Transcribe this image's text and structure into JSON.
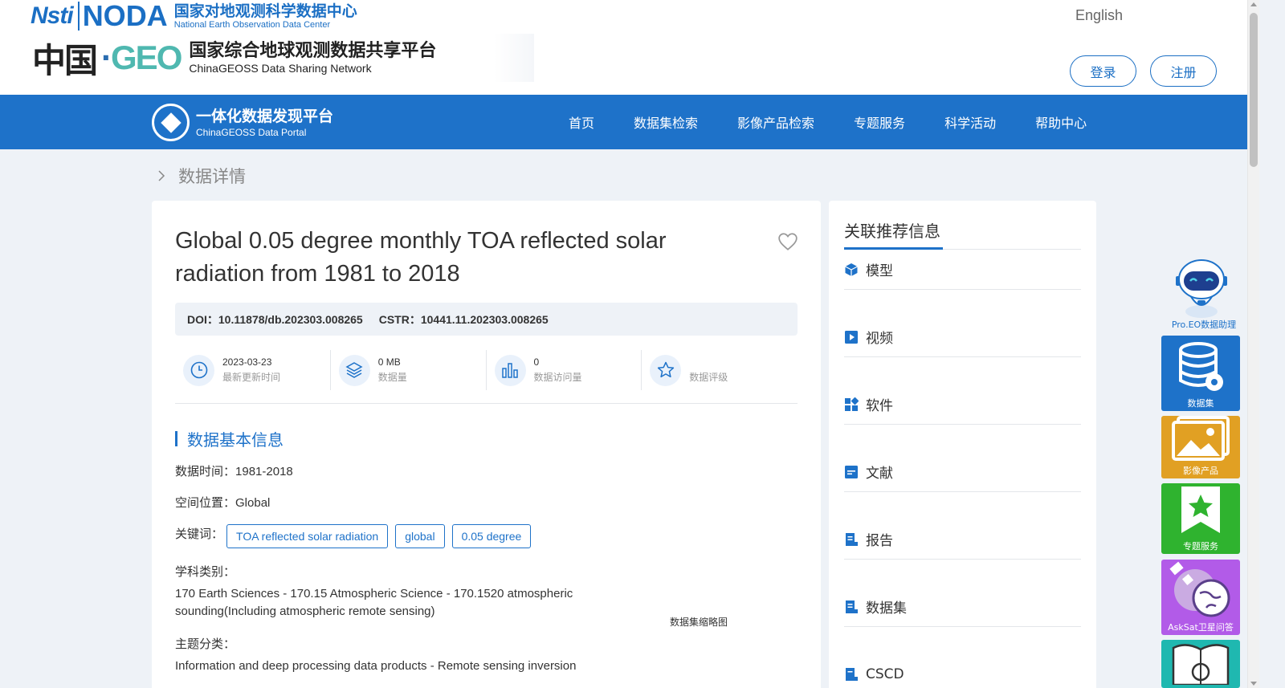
{
  "header": {
    "nsti_logo": "Nsti",
    "noda_logo": "NODA",
    "noda_cn": "国家对地观测科学数据中心",
    "noda_en": "National Earth Observation Data Center",
    "china_geo_cn": "中国",
    "china_geo_geo": "GEO",
    "geoss_cn": "国家综合地球观测数据共享平台",
    "geoss_en": "ChinaGEOSS Data Sharing Network",
    "language": "English",
    "login": "登录",
    "register": "注册"
  },
  "nav": {
    "portal_cn": "一体化数据发现平台",
    "portal_en": "ChinaGEOSS Data Portal",
    "items": [
      "首页",
      "数据集检索",
      "影像产品检索",
      "专题服务",
      "科学活动",
      "帮助中心"
    ]
  },
  "breadcrumb": {
    "current": "数据详情"
  },
  "dataset": {
    "title": "Global 0.05 degree monthly TOA reflected solar radiation from 1981 to 2018",
    "doi_label": "DOI：",
    "doi": "10.11878/db.202303.008265",
    "cstr_label": "CSTR：",
    "cstr": "10441.11.202303.008265",
    "stats": [
      {
        "value": "2023-03-23",
        "label": "最新更新时间",
        "icon": "clock-icon"
      },
      {
        "value": "0 MB",
        "label": "数据量",
        "icon": "layers-icon"
      },
      {
        "value": "0",
        "label": "数据访问量",
        "icon": "bar-chart-icon"
      },
      {
        "value": "",
        "label": "数据评级",
        "icon": "star-icon"
      }
    ],
    "section_title": "数据基本信息",
    "time_label": "数据时间：",
    "time_value": "1981-2018",
    "space_label": "空间位置：",
    "space_value": "Global",
    "keywords_label": "关键词：",
    "keywords": [
      "TOA reflected solar radiation",
      "global",
      "0.05 degree"
    ],
    "subject_label": "学科类别：",
    "subject_value": "170 Earth Sciences - 170.15 Atmospheric Science - 170.1520 atmospheric sounding(Including atmospheric remote sensing)",
    "theme_label": "主题分类：",
    "theme_value": "Information and deep processing data products - Remote sensing inversion",
    "thumbnail_label": "数据集缩略图"
  },
  "sidebar": {
    "title": "关联推荐信息",
    "items": [
      {
        "label": "模型",
        "icon": "cube-icon"
      },
      {
        "label": "视频",
        "icon": "play-icon"
      },
      {
        "label": "软件",
        "icon": "apps-icon"
      },
      {
        "label": "文献",
        "icon": "document-icon"
      },
      {
        "label": "报告",
        "icon": "report-icon"
      },
      {
        "label": "数据集",
        "icon": "dataset-icon"
      },
      {
        "label": "CSCD",
        "icon": "cscd-icon"
      }
    ]
  },
  "floating": {
    "assistant": "Pro.EO数据助理",
    "dataset": "数据集",
    "image": "影像产品",
    "topic": "专题服务",
    "asksat": "AskSat卫星问答"
  },
  "colors": {
    "primary": "#1e72c9",
    "background": "#eef2f7",
    "image_btn": "#e1a023",
    "topic_btn": "#2fb32f",
    "asksat_btn": "#b25be8"
  }
}
